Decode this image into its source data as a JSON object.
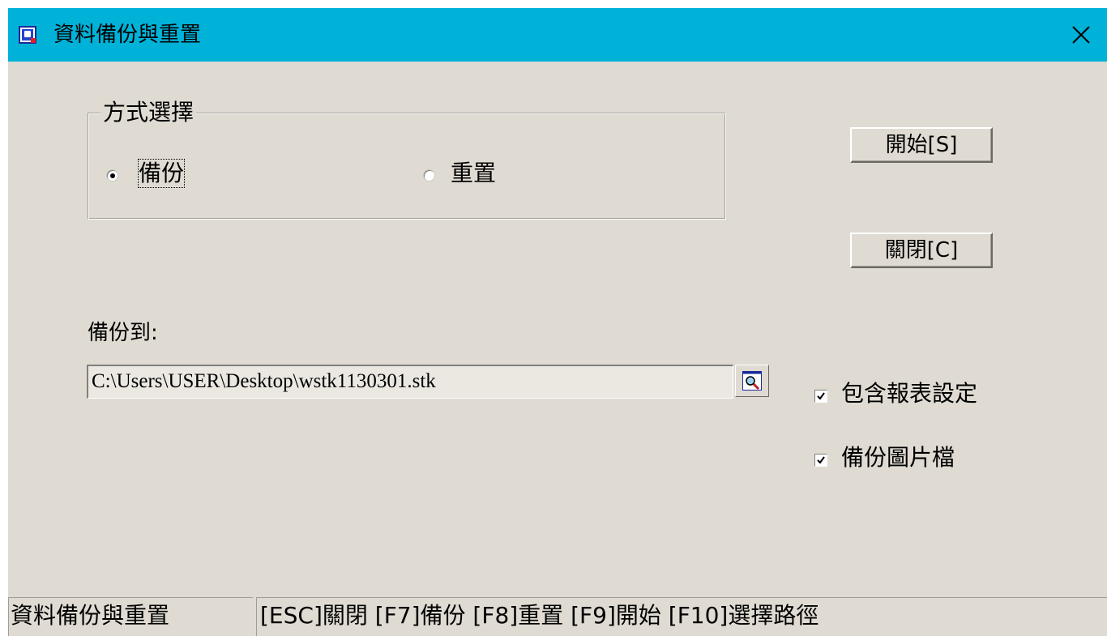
{
  "window": {
    "title": "資料備份與重置",
    "close_glyph": "✕",
    "icon": "app-icon",
    "titlebar_color": "#00b2d8",
    "background_color": "#dfdbd2"
  },
  "mode_group": {
    "legend": "方式選擇",
    "options": [
      {
        "label": "備份",
        "selected": true
      },
      {
        "label": "重置",
        "selected": false
      }
    ]
  },
  "buttons": {
    "start": "開始[S]",
    "close": "關閉[C]"
  },
  "backup_path": {
    "label": "備份到:",
    "value": "C:\\Users\\USER\\Desktop\\wstk1130301.stk",
    "browse_icon": "magnifier-icon"
  },
  "options": {
    "include_report_settings": {
      "label": "包含報表設定",
      "checked": true
    },
    "backup_images": {
      "label": "備份圖片檔",
      "checked": true
    }
  },
  "statusbar": {
    "title": "資料備份與重置",
    "shortcuts": "[ESC]關閉 [F7]備份 [F8]重置 [F9]開始 [F10]選擇路徑"
  }
}
